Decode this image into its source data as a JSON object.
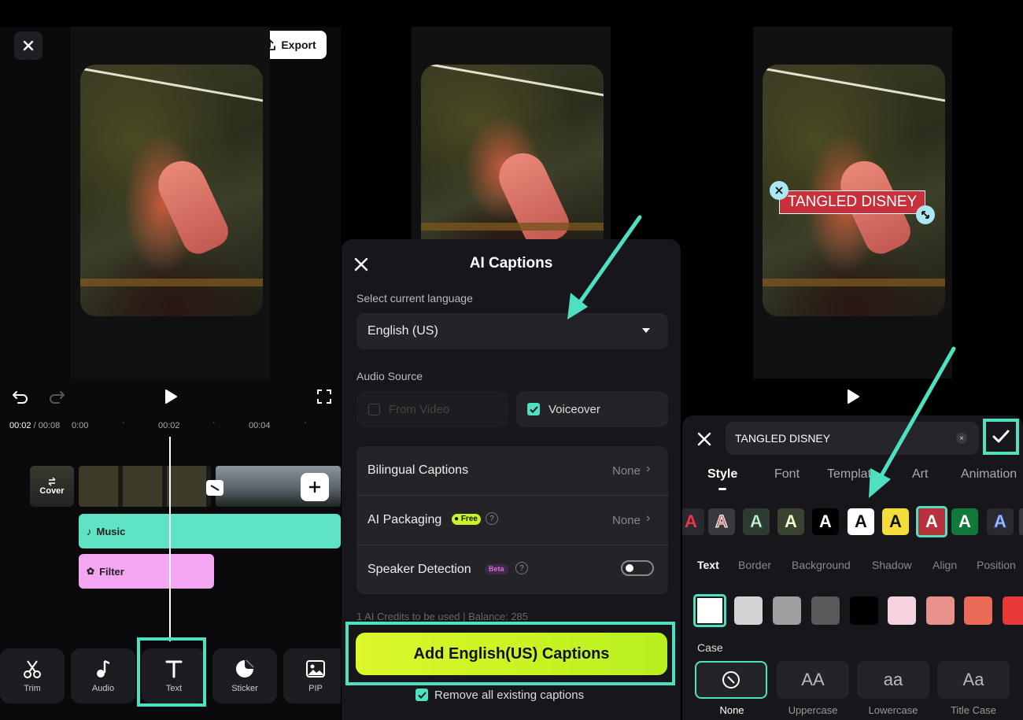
{
  "panel1": {
    "export_label": "Export",
    "time_current": "00:02",
    "time_total": "/ 00:08",
    "ruler_ticks": [
      "0:00",
      "00:02",
      "00:04"
    ],
    "cover_label": "Cover",
    "music_label": "Music",
    "filter_label": "Filter",
    "tools": [
      "Trim",
      "Audio",
      "Text",
      "Sticker",
      "PIP"
    ]
  },
  "panel2": {
    "title": "AI Captions",
    "select_language_label": "Select current language",
    "language_value": "English (US)",
    "audio_source_label": "Audio Source",
    "from_video_label": "From Video",
    "voiceover_label": "Voiceover",
    "bilingual_label": "Bilingual Captions",
    "bilingual_value": "None",
    "ai_packaging_label": "AI Packaging",
    "free_badge": "Free",
    "ai_packaging_value": "None",
    "speaker_detection_label": "Speaker Detection",
    "beta_badge": "Beta",
    "credits_text": "1 AI Credits to be used | Balance: 285",
    "add_button_label": "Add English(US) Captions",
    "remove_existing_label": "Remove all existing captions"
  },
  "panel3": {
    "overlay_text": "TANGLED DISNEY",
    "text_input_value": "TANGLED DISNEY",
    "tabs": [
      "Style",
      "Font",
      "Template",
      "Art",
      "Animation"
    ],
    "subtabs": [
      "Text",
      "Border",
      "Background",
      "Shadow",
      "Align",
      "Position"
    ],
    "style_letter": "A",
    "colors": [
      "#ffffff",
      "#d4d4d4",
      "#9e9e9e",
      "#595959",
      "#000000",
      "#f7d3e0",
      "#e8918a",
      "#ec6a58",
      "#e8383a"
    ],
    "case_label": "Case",
    "case_options": [
      {
        "glyph": "",
        "label": "None"
      },
      {
        "glyph": "AA",
        "label": "Uppercase"
      },
      {
        "glyph": "aa",
        "label": "Lowercase"
      },
      {
        "glyph": "Aa",
        "label": "Title Case"
      }
    ]
  },
  "accent_color": "#4fe0c2",
  "button_color": "#c8f52a"
}
